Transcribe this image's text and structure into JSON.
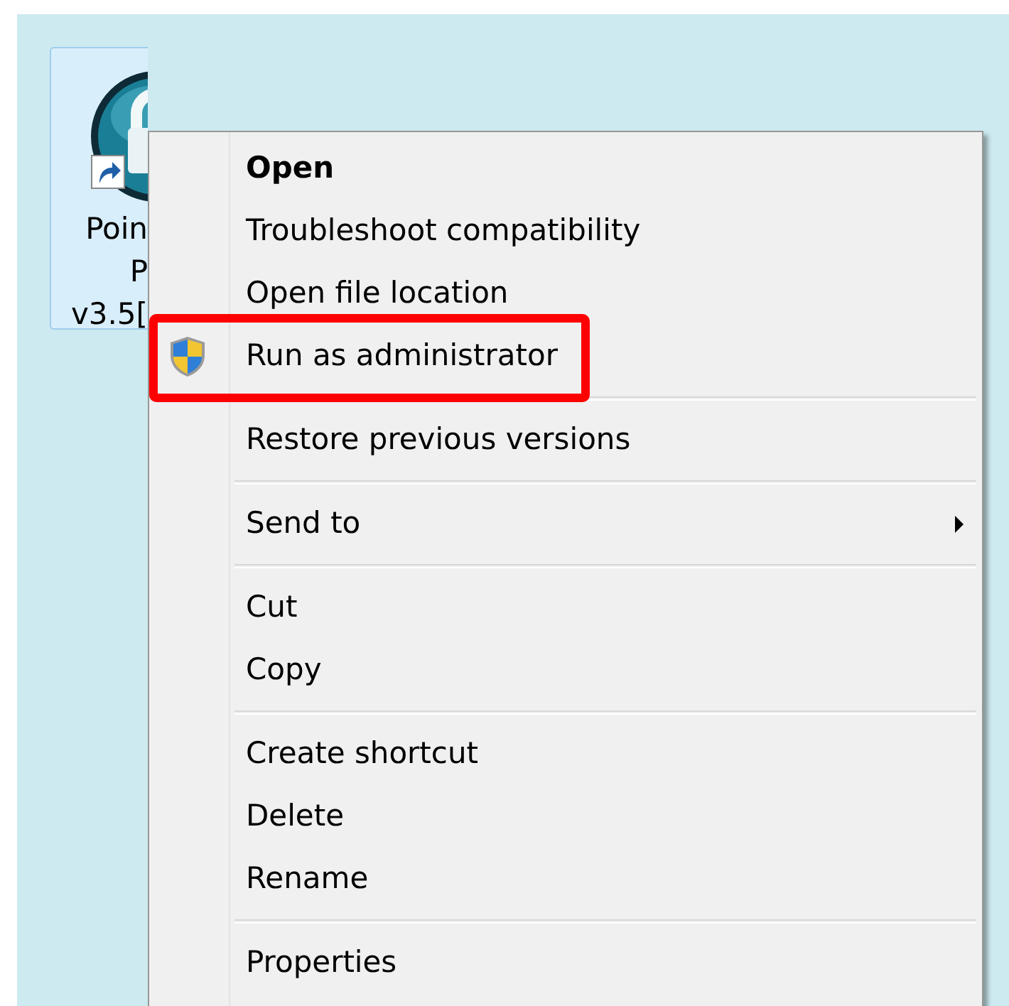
{
  "desktop_icon": {
    "label_lines": [
      "Poin",
      "P",
      "v3.5["
    ],
    "selected": true
  },
  "context_menu": {
    "groups": [
      [
        {
          "label": "Open",
          "default": true,
          "elevated": false,
          "submenu": false,
          "highlighted": false
        },
        {
          "label": "Troubleshoot compatibility",
          "default": false,
          "elevated": false,
          "submenu": false,
          "highlighted": false
        },
        {
          "label": "Open file location",
          "default": false,
          "elevated": false,
          "submenu": false,
          "highlighted": false
        },
        {
          "label": "Run as administrator",
          "default": false,
          "elevated": true,
          "submenu": false,
          "highlighted": true
        }
      ],
      [
        {
          "label": "Restore previous versions",
          "default": false,
          "elevated": false,
          "submenu": false,
          "highlighted": false
        }
      ],
      [
        {
          "label": "Send to",
          "default": false,
          "elevated": false,
          "submenu": true,
          "highlighted": false
        }
      ],
      [
        {
          "label": "Cut",
          "default": false,
          "elevated": false,
          "submenu": false,
          "highlighted": false
        },
        {
          "label": "Copy",
          "default": false,
          "elevated": false,
          "submenu": false,
          "highlighted": false
        }
      ],
      [
        {
          "label": "Create shortcut",
          "default": false,
          "elevated": false,
          "submenu": false,
          "highlighted": false
        },
        {
          "label": "Delete",
          "default": false,
          "elevated": false,
          "submenu": false,
          "highlighted": false
        },
        {
          "label": "Rename",
          "default": false,
          "elevated": false,
          "submenu": false,
          "highlighted": false
        }
      ],
      [
        {
          "label": "Properties",
          "default": false,
          "elevated": false,
          "submenu": false,
          "highlighted": false
        }
      ]
    ]
  }
}
